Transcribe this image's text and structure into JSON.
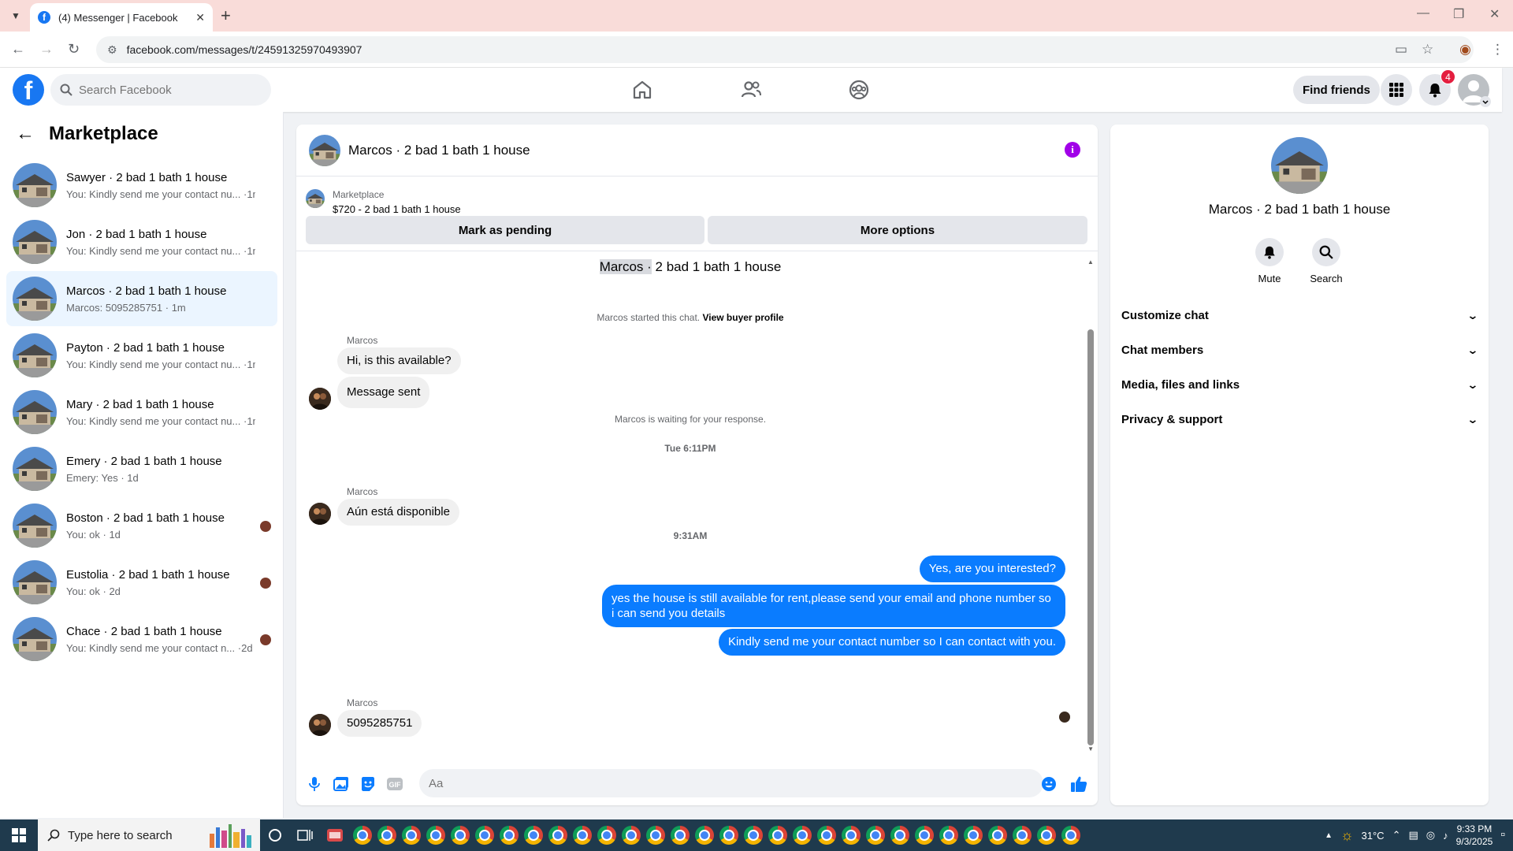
{
  "browser": {
    "tab_title": "(4) Messenger | Facebook",
    "url": "facebook.com/messages/t/24591325970493907"
  },
  "header": {
    "search_placeholder": "Search Facebook",
    "find_friends": "Find friends",
    "notification_count": "4"
  },
  "sidebar": {
    "title": "Marketplace",
    "conversations": [
      {
        "name": "Sawyer · 2 bad 1 bath 1 house",
        "preview": "You: Kindly send me your contact nu... ·1m",
        "active": false,
        "seen": false
      },
      {
        "name": "Jon · 2 bad 1 bath 1 house",
        "preview": "You: Kindly send me your contact nu... ·1m",
        "active": false,
        "seen": false
      },
      {
        "name": "Marcos · 2 bad 1 bath 1 house",
        "preview": "Marcos: 5095285751 · 1m",
        "active": true,
        "seen": false
      },
      {
        "name": "Payton · 2 bad 1 bath 1 house",
        "preview": "You: Kindly send me your contact nu... ·1m",
        "active": false,
        "seen": false
      },
      {
        "name": "Mary · 2 bad 1 bath 1 house",
        "preview": "You: Kindly send me your contact nu... ·1m",
        "active": false,
        "seen": false
      },
      {
        "name": "Emery · 2 bad 1 bath 1 house",
        "preview": "Emery: Yes · 1d",
        "active": false,
        "seen": false
      },
      {
        "name": "Boston · 2 bad 1 bath 1 house",
        "preview": "You: ok · 1d",
        "active": false,
        "seen": true
      },
      {
        "name": "Eustolia · 2 bad 1 bath 1 house",
        "preview": "You: ok · 2d",
        "active": false,
        "seen": true
      },
      {
        "name": "Chace · 2 bad 1 bath 1 house",
        "preview": "You: Kindly send me your contact n... ·2d",
        "active": false,
        "seen": true
      }
    ]
  },
  "chat": {
    "title": "Marcos · 2 bad 1 bath 1 house",
    "marketplace_label": "Marketplace",
    "listing": "$720 - 2 bad 1 bath 1 house",
    "mark_pending": "Mark as pending",
    "more_options": "More options",
    "center_title_hl": "Marcos ·",
    "center_title_rest": " 2 bad 1 bath 1 house",
    "started_text": "Marcos started this chat.",
    "view_profile": "View buyer profile",
    "sender": "Marcos",
    "msg1": "Hi, is this available?",
    "msg2": "Message sent",
    "waiting": "Marcos is waiting for your response.",
    "ts1": "Tue 6:11PM",
    "msg3": "Aún está disponible",
    "ts2": "9:31AM",
    "out1": "Yes, are you interested?",
    "out2": "yes the house is still available for rent,please send your email and phone number so i can send you details",
    "out3": "Kindly send me your contact number so I can contact with you.",
    "msg4": "5095285751",
    "composer_placeholder": "Aa"
  },
  "rpanel": {
    "name": "Marcos · 2 bad 1 bath 1 house",
    "mute": "Mute",
    "search": "Search",
    "sections": [
      "Customize chat",
      "Chat members",
      "Media, files and links",
      "Privacy & support"
    ]
  },
  "taskbar": {
    "search_placeholder": "Type here to search",
    "temperature": "31°C",
    "time": "9:33 PM",
    "date": "9/3/2025"
  }
}
